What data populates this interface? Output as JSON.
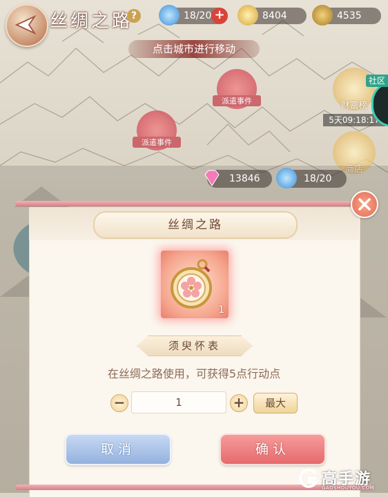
{
  "header": {
    "title": "丝绸之路",
    "help_icon": "?",
    "action_points": "18/20",
    "gold": "8404",
    "coins": "4535"
  },
  "map": {
    "hint": "点击城市进行移动",
    "events": [
      "派遣事件",
      "派遣事件"
    ],
    "wealth_rank_label": "财富榜",
    "shop_label": "商店",
    "timer": "5天09:18:17",
    "community_label": "社区"
  },
  "overlay_resources": {
    "gems": "13846",
    "action_points": "18/20"
  },
  "dialog": {
    "title": "丝绸之路",
    "item": {
      "name": "须臾怀表",
      "count": "1",
      "description": "在丝绸之路使用，可获得5点行动点"
    },
    "quantity": {
      "minus": "−",
      "value": "1",
      "plus": "+",
      "max_label": "最大"
    },
    "cancel_label": "取消",
    "confirm_label": "确认"
  },
  "watermark": {
    "text": "高手游",
    "domain": "GAOSHOUYOU.COM"
  },
  "colors": {
    "accent_pink": "#e66a6d",
    "cancel_blue": "#93b1de",
    "text_brown": "#6c4a37"
  }
}
